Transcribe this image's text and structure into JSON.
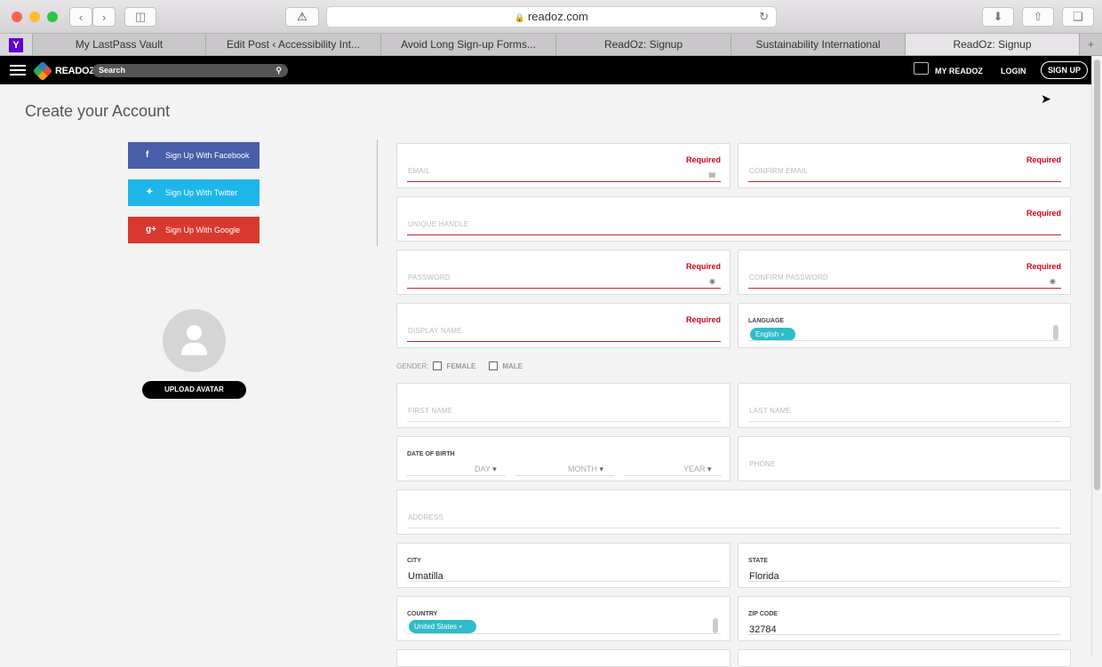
{
  "browser": {
    "url": "readoz.com",
    "tabs": [
      "My LastPass Vault",
      "Edit Post ‹ Accessibility Int...",
      "Avoid Long Sign-up Forms...",
      "ReadOz: Signup",
      "Sustainability International",
      "ReadOz: Signup"
    ],
    "active_tab": 5
  },
  "topbar": {
    "logo": "READOZ",
    "search_placeholder": "Search",
    "my_readoz": "MY READOZ",
    "login": "LOGIN",
    "signup": "SIGN UP"
  },
  "page": {
    "title": "Create your Account",
    "social": [
      {
        "label": "Sign Up With Facebook",
        "icon": "f",
        "color": "#4a5dab"
      },
      {
        "label": "Sign Up With Twitter",
        "icon": "t",
        "color": "#1eb6ea"
      },
      {
        "label": "Sign Up With Google",
        "icon": "g+",
        "color": "#d8392e"
      }
    ],
    "upload_avatar": "UPLOAD AVATAR"
  },
  "form": {
    "required": "Required",
    "email": "EMAIL",
    "confirm_email": "CONFIRM EMAIL",
    "handle": "UNIQUE HANDLE",
    "password": "PASSWORD",
    "confirm_password": "CONFIRM PASSWORD",
    "display_name": "DISPLAY NAME",
    "language_label": "LANGUAGE",
    "language_value": "English",
    "gender_label": "GENDER:",
    "female": "FEMALE",
    "male": "MALE",
    "first_name": "FIRST NAME",
    "last_name": "LAST NAME",
    "dob_label": "DATE OF BIRTH",
    "day": "DAY",
    "month": "MONTH",
    "year": "YEAR",
    "phone": "PHONE",
    "address": "ADDRESS",
    "city_label": "CITY",
    "city_value": "Umatilla",
    "state_label": "STATE",
    "state_value": "Florida",
    "country_label": "COUNTRY",
    "country_value": "United States",
    "zip_label": "ZIP CODE",
    "zip_value": "32784"
  }
}
